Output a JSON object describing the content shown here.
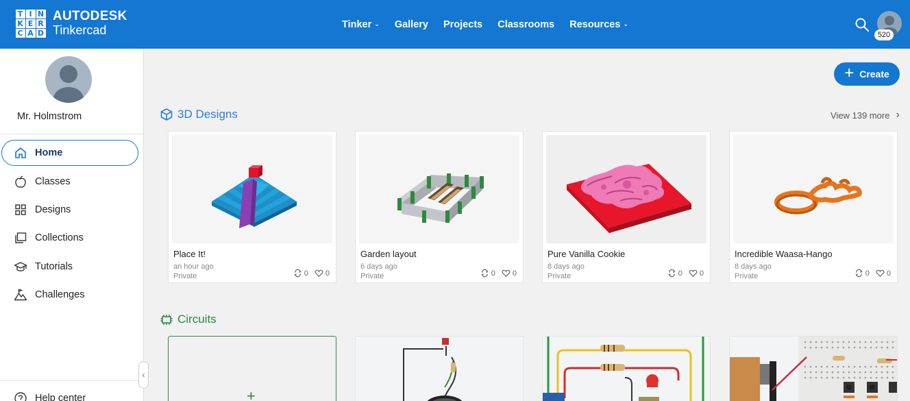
{
  "logo": {
    "grid": [
      "T",
      "I",
      "N",
      "K",
      "E",
      "R",
      "C",
      "A",
      "D"
    ],
    "brand_top": "AUTODESK",
    "brand_bottom": "Tinkercad"
  },
  "nav": {
    "items": [
      {
        "label": "Tinker",
        "dropdown": true
      },
      {
        "label": "Gallery",
        "dropdown": false
      },
      {
        "label": "Projects",
        "dropdown": false
      },
      {
        "label": "Classrooms",
        "dropdown": false
      },
      {
        "label": "Resources",
        "dropdown": true
      }
    ],
    "dropdown_glyph": "⌄",
    "search_icon": "search-icon",
    "badge": "520"
  },
  "sidebar": {
    "profile_name": "Mr. Holmstrom",
    "items": [
      {
        "label": "Home",
        "icon": "home-icon",
        "active": true
      },
      {
        "label": "Classes",
        "icon": "apple-icon"
      },
      {
        "label": "Designs",
        "icon": "grid-icon"
      },
      {
        "label": "Collections",
        "icon": "folders-icon"
      },
      {
        "label": "Tutorials",
        "icon": "graduation-cap-icon"
      },
      {
        "label": "Challenges",
        "icon": "mountain-icon"
      }
    ],
    "help_label": "Help center",
    "collapse_glyph": "‹"
  },
  "main": {
    "create_label": "Create",
    "designs_section": {
      "title": "3D Designs",
      "view_more": "View 139 more"
    },
    "designs": [
      {
        "name": "Place It!",
        "age": "an hour ago",
        "visibility": "Private",
        "copies": "0",
        "likes": "0"
      },
      {
        "name": "Garden layout",
        "age": "6 days ago",
        "visibility": "Private",
        "copies": "0",
        "likes": "0"
      },
      {
        "name": "Pure Vanilla Cookie",
        "age": "8 days ago",
        "visibility": "Private",
        "copies": "0",
        "likes": "0"
      },
      {
        "name": "Incredible Waasa-Hango",
        "age": "8 days ago",
        "visibility": "Private",
        "copies": "0",
        "likes": "0"
      }
    ],
    "circuits_section": {
      "title": "Circuits"
    },
    "new_circuit_glyph": "+"
  },
  "colors": {
    "brand_blue": "#1477d1",
    "circuits_green": "#2a8a45",
    "section_blue": "#2d7ed6"
  }
}
